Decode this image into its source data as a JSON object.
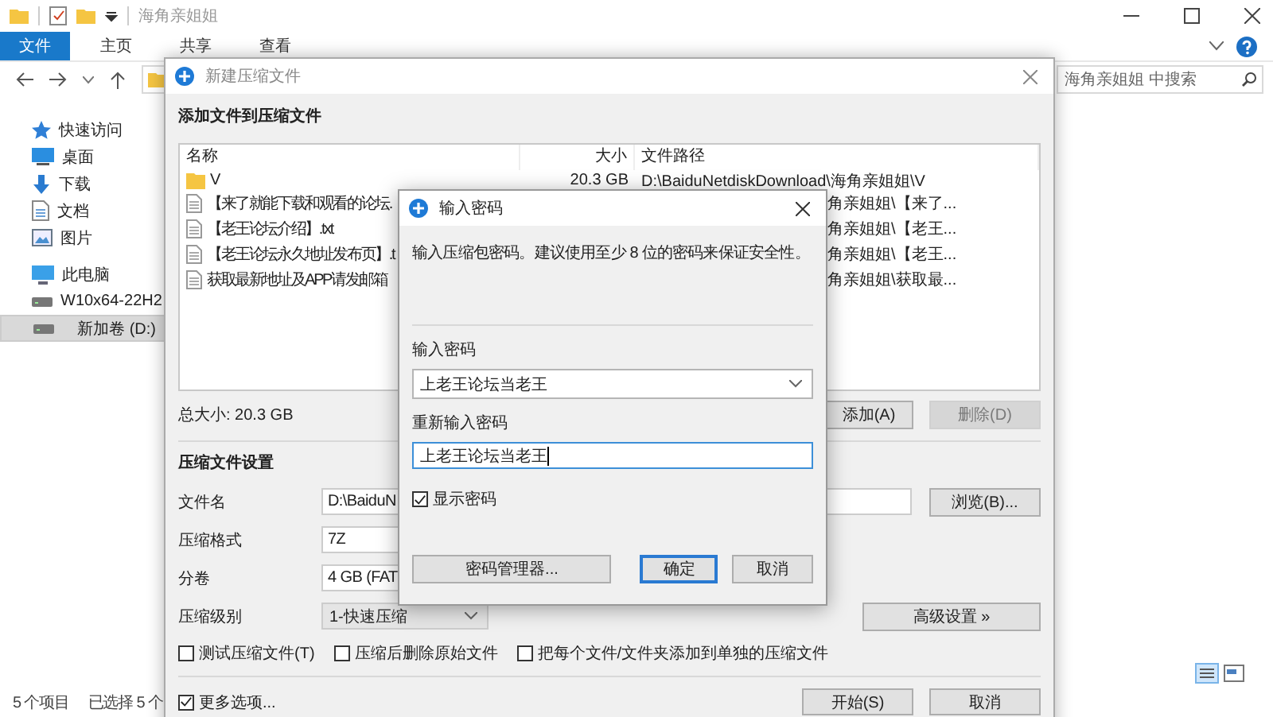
{
  "explorer": {
    "title": "海角亲姐姐",
    "ribbon_tabs": [
      {
        "label": "文件",
        "selected": true
      },
      {
        "label": "主页",
        "selected": false
      },
      {
        "label": "共享",
        "selected": false
      },
      {
        "label": "查看",
        "selected": false
      }
    ],
    "search": {
      "placeholder": "海角亲姐姐 中搜索"
    },
    "nav": [
      {
        "label": "快速访问",
        "kind": "star",
        "selected": false,
        "children": [
          {
            "label": "桌面",
            "kind": "desktop",
            "selected": false
          },
          {
            "label": "下载",
            "kind": "download",
            "selected": false
          },
          {
            "label": "文档",
            "kind": "document",
            "selected": false
          },
          {
            "label": "图片",
            "kind": "picture",
            "selected": false
          }
        ]
      },
      {
        "label": "此电脑",
        "kind": "computer",
        "selected": false,
        "children": [
          {
            "label": "W10x64-22H2",
            "kind": "drive",
            "selected": false
          },
          {
            "label": "新加卷 (D:)",
            "kind": "drive",
            "selected": true
          }
        ]
      }
    ],
    "status": [
      "5 个项目",
      "已选择 5 个"
    ]
  },
  "archive_dialog": {
    "title": "新建压缩文件",
    "heading": "添加文件到压缩文件",
    "columns": [
      "名称",
      "大小",
      "文件路径"
    ],
    "files": [
      {
        "kind": "folder",
        "name": "V",
        "size": "20.3 GB",
        "path": "D:\\BaiduNetdiskDownload\\海角亲姐姐\\V"
      },
      {
        "kind": "file",
        "name": "【来了就能下载和观看的论坛.",
        "path": "角亲姐姐\\【来了..."
      },
      {
        "kind": "file",
        "name": "【老王论坛介绍】.txt",
        "path": "角亲姐姐\\【老王..."
      },
      {
        "kind": "file",
        "name": "【老王论坛永久地址发布页】.t",
        "path": "角亲姐姐\\【老王..."
      },
      {
        "kind": "file",
        "name": "获取最新地址及APP请发邮箱",
        "path": "角亲姐姐\\获取最..."
      }
    ],
    "total": "总大小: 20.3 GB",
    "list_buttons": [
      {
        "label": "添加(A)",
        "disabled": false
      },
      {
        "label": "删除(D)",
        "disabled": true
      }
    ],
    "settings_heading": "压缩文件设置",
    "fields": [
      {
        "label": "文件名",
        "kind": "text",
        "value": "D:\\BaiduN"
      },
      {
        "label": "压缩格式",
        "kind": "text",
        "value": "7Z"
      },
      {
        "label": "分卷",
        "kind": "text",
        "value": "4 GB (FAT"
      },
      {
        "label": "压缩级别",
        "kind": "select",
        "value": "1-快速压缩"
      }
    ],
    "browse_button": "浏览(B)...",
    "advanced_button": "高级设置 »",
    "options": [
      {
        "label": "测试压缩文件(T)",
        "checked": false
      },
      {
        "label": "压缩后删除原始文件",
        "checked": false
      },
      {
        "label": "把每个文件/文件夹添加到单独的压缩文件",
        "checked": false
      }
    ],
    "more_options": {
      "label": "更多选项...",
      "checked": true
    },
    "buttons": [
      "开始(S)",
      "取消"
    ]
  },
  "password_dialog": {
    "title": "输入密码",
    "message": "输入压缩包密码。建议使用至少 8 位的密码来保证安全性。",
    "password_label": "输入密码",
    "password": "上老王论坛当老王",
    "confirm_label": "重新输入密码",
    "confirm": "上老王论坛当老王",
    "show_password": {
      "label": "显示密码",
      "checked": true
    },
    "manager_button": "密码管理器...",
    "ok_button": "确定",
    "cancel_button": "取消"
  }
}
